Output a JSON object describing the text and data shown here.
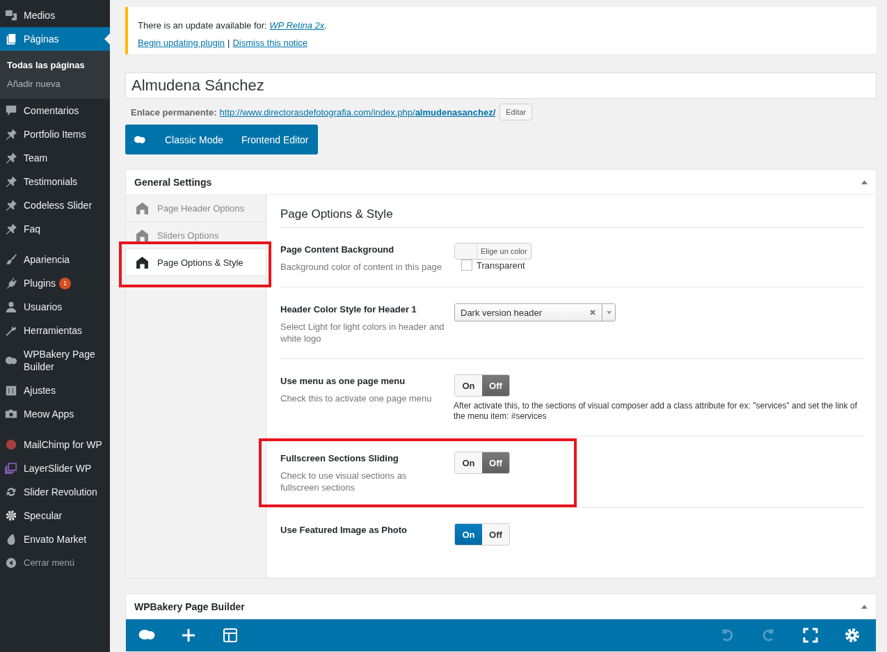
{
  "sidebar": {
    "groups": [
      [
        {
          "label": "Medios",
          "selected": false
        },
        {
          "label": "Páginas",
          "selected": true,
          "children": [
            {
              "label": "Todas las páginas",
              "selected": true
            },
            {
              "label": "Añadir nueva",
              "selected": false
            }
          ]
        },
        {
          "label": "Comentarios",
          "selected": false
        },
        {
          "label": "Portfolio Items",
          "selected": false
        },
        {
          "label": "Team",
          "selected": false
        },
        {
          "label": "Testimonials",
          "selected": false
        },
        {
          "label": "Codeless Slider",
          "selected": false
        },
        {
          "label": "Faq",
          "selected": false
        }
      ],
      [
        {
          "label": "Apariencia",
          "selected": false
        },
        {
          "label": "Plugins",
          "selected": false,
          "badge": "1"
        },
        {
          "label": "Usuarios",
          "selected": false
        },
        {
          "label": "Herramientas",
          "selected": false
        },
        {
          "label": "WPBakery Page Builder",
          "selected": false
        },
        {
          "label": "Ajustes",
          "selected": false
        },
        {
          "label": "Meow Apps",
          "selected": false
        }
      ],
      [
        {
          "label": "MailChimp for WP",
          "selected": false
        },
        {
          "label": "LayerSlider WP",
          "selected": false
        },
        {
          "label": "Slider Revolution",
          "selected": false
        },
        {
          "label": "Specular",
          "selected": false
        },
        {
          "label": "Envato Market",
          "selected": false
        }
      ]
    ],
    "collapse": "Cerrar menú"
  },
  "notice": {
    "text": "There is an update available for:",
    "link": "WP Retina 2x",
    "after": ".",
    "actions": [
      "Begin updating plugin",
      "Dismiss this notice"
    ],
    "separator": "|"
  },
  "title": {
    "value": "Almudena Sánchez"
  },
  "permalink": {
    "label": "Enlace permanente:",
    "url": "http://www.directorasdefotografia.com/index.php/**almudenasanchez/**",
    "button": "Editar"
  },
  "editor_modes": [
    "Classic Mode",
    "Frontend Editor"
  ],
  "general_settings": {
    "title": "General Settings",
    "tabs": [
      {
        "label": "Page Header Options",
        "selected": false,
        "highlighted": false
      },
      {
        "label": "Sliders Options",
        "selected": false,
        "highlighted": false
      },
      {
        "label": "Page Options & Style",
        "selected": true,
        "highlighted": true
      }
    ],
    "heading": "Page Options & Style",
    "settings": [
      {
        "kind": "color",
        "label": "Page Content Background",
        "description": "Background color of content in this page",
        "button": "Elige un color",
        "checkbox": {
          "label": "Transparent",
          "checked": false
        },
        "highlighted": false
      },
      {
        "kind": "select",
        "label": "Header Color Style for Header 1",
        "description": "Select Light for light colors in header and white logo",
        "value": "Dark version header",
        "highlighted": false
      },
      {
        "kind": "toggle",
        "label": "Use menu as one page menu",
        "description": "Check this to activate one page menu",
        "on_label": "On",
        "off_label": "Off",
        "on": false,
        "note": "After activate this, to the sections of visual composer add a class attribute for ex: \"services\" and set the link of the menu item: #services",
        "highlighted": false
      },
      {
        "kind": "toggle",
        "label": "Fullscreen Sections Sliding",
        "description": "Check to use visual sections as fullscreen sections",
        "on_label": "On",
        "off_label": "Off",
        "on": false,
        "highlighted": true
      },
      {
        "kind": "toggle",
        "label": "Use Featured Image as Photo",
        "on_label": "On",
        "off_label": "Off",
        "on": true,
        "highlighted": false
      }
    ]
  },
  "page_builder": {
    "title": "WPBakery Page Builder",
    "toolbar": [
      {
        "disabled": false
      },
      {
        "disabled": false
      },
      {
        "disabled": false
      },
      {
        "disabled": true
      },
      {
        "disabled": true
      },
      {
        "disabled": false
      },
      {
        "disabled": false
      }
    ]
  }
}
